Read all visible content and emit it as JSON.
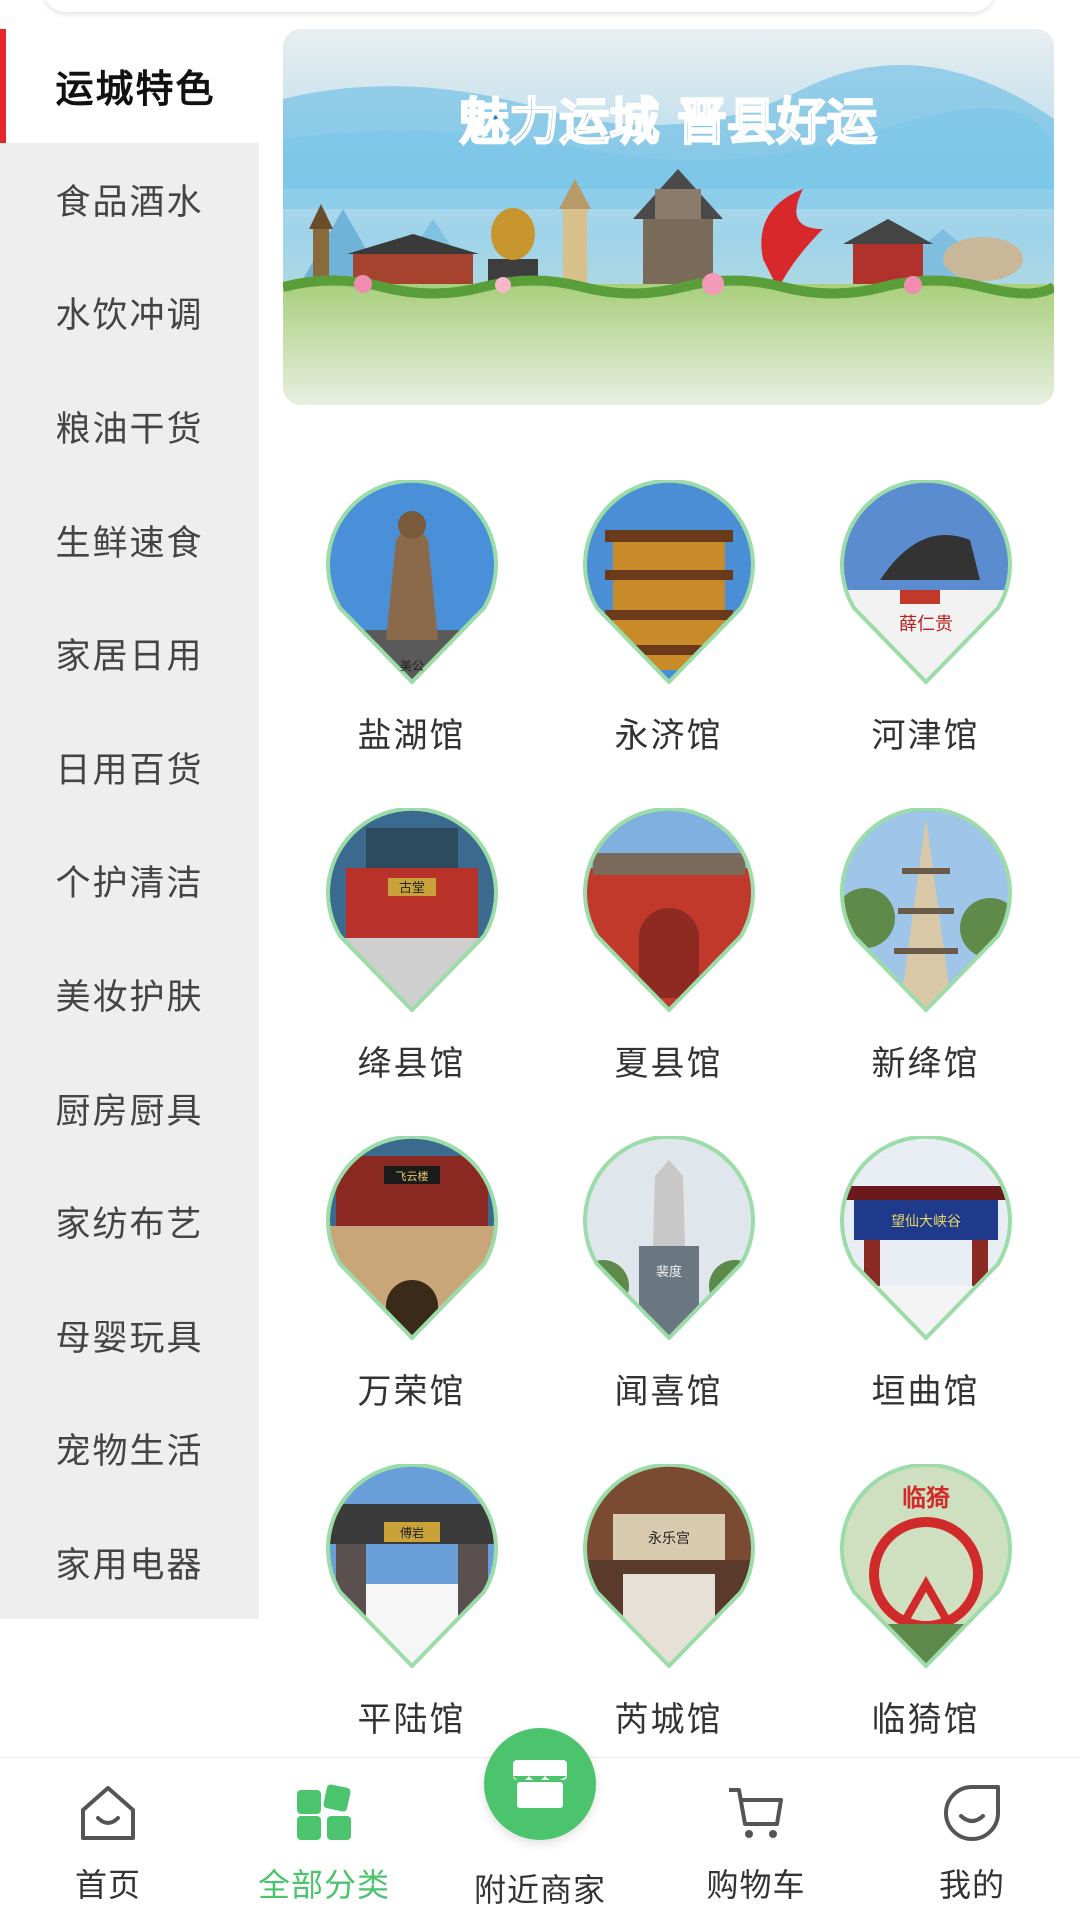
{
  "sidebar": {
    "items": [
      {
        "label": "运城特色",
        "active": true
      },
      {
        "label": "食品酒水"
      },
      {
        "label": "水饮冲调"
      },
      {
        "label": "粮油干货"
      },
      {
        "label": "生鲜速食"
      },
      {
        "label": "家居日用"
      },
      {
        "label": "日用百货"
      },
      {
        "label": "个护清洁"
      },
      {
        "label": "美妆护肤"
      },
      {
        "label": "厨房厨具"
      },
      {
        "label": "家纺布艺"
      },
      {
        "label": "母婴玩具"
      },
      {
        "label": "宠物生活"
      },
      {
        "label": "家用电器"
      }
    ]
  },
  "banner": {
    "title": "魅力运城 晋县好运"
  },
  "venues": [
    {
      "label": "盐湖馆",
      "sign": "美公"
    },
    {
      "label": "永济馆"
    },
    {
      "label": "河津馆",
      "sign": "薛仁贵"
    },
    {
      "label": "绛县馆",
      "sign": "古堂"
    },
    {
      "label": "夏县馆"
    },
    {
      "label": "新绛馆"
    },
    {
      "label": "万荣馆",
      "sign": "飞云楼"
    },
    {
      "label": "闻喜馆",
      "sign": "裴度"
    },
    {
      "label": "垣曲馆",
      "sign": "望仙大峡谷"
    },
    {
      "label": "平陆馆",
      "sign": "傅岩"
    },
    {
      "label": "芮城馆",
      "sign": "永乐宫"
    },
    {
      "label": "临猗馆",
      "sign": "临猗"
    }
  ],
  "bottom_nav": {
    "items": [
      {
        "label": "首页",
        "icon": "home-icon"
      },
      {
        "label": "全部分类",
        "icon": "category-icon",
        "active": true
      },
      {
        "label": "附近商家",
        "icon": "store-icon"
      },
      {
        "label": "购物车",
        "icon": "cart-icon"
      },
      {
        "label": "我的",
        "icon": "smile-icon"
      }
    ]
  },
  "colors": {
    "accent": "#4cc46d",
    "active_marker": "#e5262a",
    "sidebar_bg": "#eeeeee"
  }
}
